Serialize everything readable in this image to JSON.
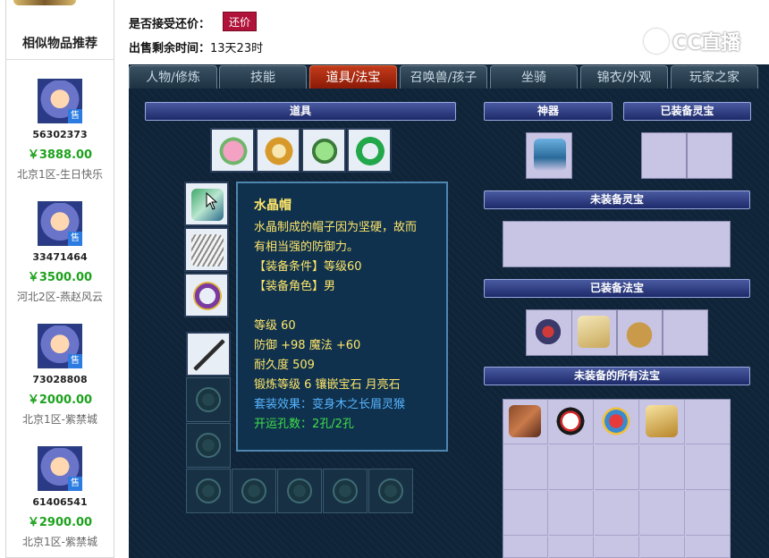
{
  "sidebar": {
    "title": "相似物品推荐",
    "items": [
      {
        "id": "56302373",
        "price": "￥3888.00",
        "server": "北京1区-生日快乐",
        "sell_label": "售"
      },
      {
        "id": "33471464",
        "price": "￥3500.00",
        "server": "河北2区-燕赵风云",
        "sell_label": "售"
      },
      {
        "id": "73028808",
        "price": "￥2000.00",
        "server": "北京1区-紫禁城",
        "sell_label": "售"
      },
      {
        "id": "61406541",
        "price": "￥2900.00",
        "server": "北京1区-紫禁城",
        "sell_label": "售"
      }
    ]
  },
  "info": {
    "bargain_label": "是否接受还价：",
    "bargain_button": "还价",
    "time_label": "出售剩余时间：",
    "time_value": "13天23时"
  },
  "watermark": "CC直播",
  "tabs": [
    {
      "label": "人物/修炼",
      "active": false
    },
    {
      "label": "技能",
      "active": false
    },
    {
      "label": "道具/法宝",
      "active": true
    },
    {
      "label": "召唤兽/孩子",
      "active": false
    },
    {
      "label": "坐骑",
      "active": false
    },
    {
      "label": "锦衣/外观",
      "active": false
    },
    {
      "label": "玩家之家",
      "active": false
    }
  ],
  "sections": {
    "items": "道具",
    "artifact": "神器",
    "equipped_spirit": "已装备灵宝",
    "unequipped_spirit": "未装备灵宝",
    "equipped_treasure": "已装备法宝",
    "all_unequipped_treasure": "未装备的所有法宝"
  },
  "tooltip": {
    "name": "水晶帽",
    "desc1": "水晶制成的帽子因为坚硬，故而",
    "desc2": "有相当强的防御力。",
    "req_level": "【装备条件】等级60",
    "req_role": "【装备角色】男",
    "level": "等级 60",
    "defense": "防御 +98 魔法 +60",
    "durability": "耐久度 509",
    "forge": "锻炼等级 6 镶嵌宝石 月亮石",
    "set_effect": "套装效果：变身木之长眉灵猴",
    "holes": "开运孔数：2孔/2孔"
  },
  "colors": {
    "active_tab": "#c23a1a",
    "price": "#1ea21e",
    "tooltip_text": "#ffe66a",
    "set_text": "#57b4ff",
    "hole_text": "#3fe04a"
  }
}
